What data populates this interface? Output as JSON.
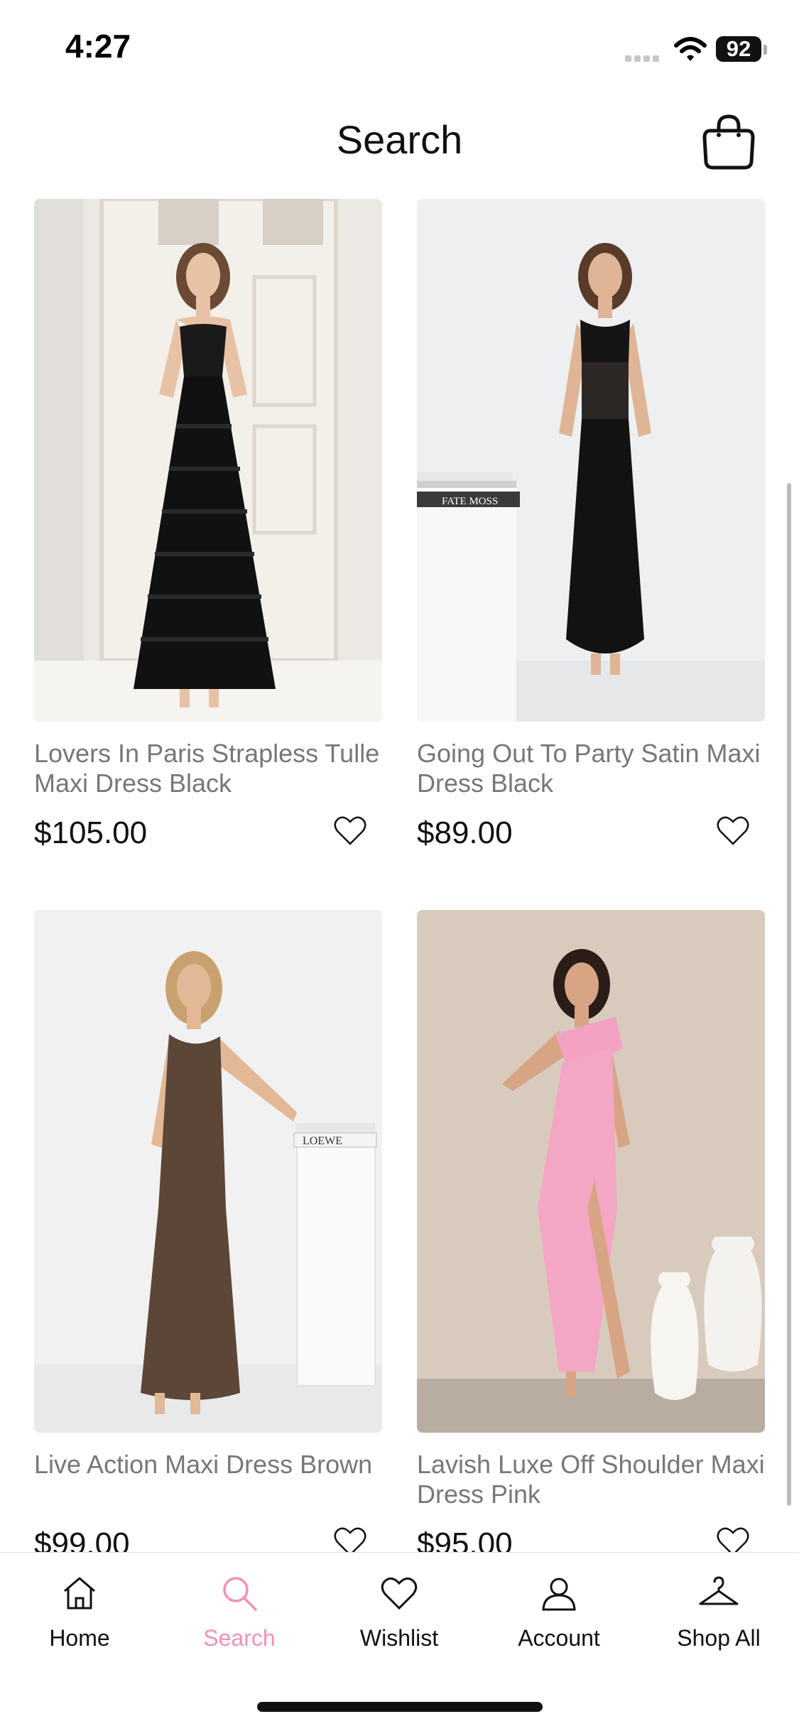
{
  "status_bar": {
    "time": "4:27",
    "battery": "92"
  },
  "header": {
    "title": "Search",
    "cart_icon": "shopping-bag-icon"
  },
  "products": [
    {
      "name": "Lovers In Paris Strapless Tulle Maxi Dress Black",
      "price": "$105.00"
    },
    {
      "name": "Going Out To Party Satin Maxi Dress Black",
      "price": "$89.00"
    },
    {
      "name": "Live Action Maxi Dress Brown",
      "price": "$99.00"
    },
    {
      "name": "Lavish Luxe Off Shoulder Maxi Dress Pink",
      "price": "$95.00"
    }
  ],
  "props": {
    "book_stack_1": "FATE MOSS",
    "book_stack_2": "LOEWE"
  },
  "tabbar": {
    "items": [
      {
        "label": "Home",
        "icon": "home-icon"
      },
      {
        "label": "Search",
        "icon": "search-icon",
        "active": true
      },
      {
        "label": "Wishlist",
        "icon": "heart-icon"
      },
      {
        "label": "Account",
        "icon": "user-icon"
      },
      {
        "label": "Shop All",
        "icon": "hanger-icon"
      }
    ]
  },
  "colors": {
    "accent": "#f58fb8",
    "text": "#111111",
    "muted": "#777777"
  }
}
